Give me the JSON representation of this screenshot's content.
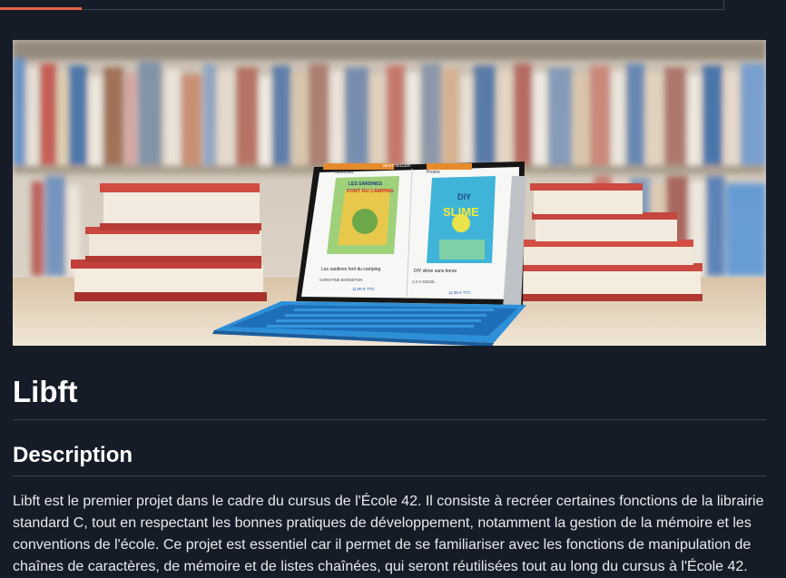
{
  "nav": {
    "active_tab_color": "#e8654a"
  },
  "hero": {
    "image_alt": "Illustration de la librairie Libft",
    "book_left": {
      "tag_top": "Nouveau",
      "tag_mid": "BEST SELLER",
      "cover_title_1": "LES SARDINES",
      "cover_title_2": "FONT DU CAMPING",
      "caption": "Les sardines font du camping",
      "author": "CHRISTINE BONNETON",
      "price": "11,90 € TTC"
    },
    "book_right": {
      "tag_top": "Promo",
      "cover_title_1": "DIY",
      "cover_title_2": "SLIME",
      "caption": "DIY slime sans borax",
      "author": "1-2-3 SOLEIL",
      "price": "11,95 € TTC"
    }
  },
  "project": {
    "title": "Libft",
    "section_title": "Description",
    "description": "Libft est le premier projet dans le cadre du cursus de l'École 42. Il consiste à recréer certaines fonctions de la librairie standard C, tout en respectant les bonnes pratiques de développement, notamment la gestion de la mémoire et les conventions de l'école. Ce projet est essentiel car il permet de se familiariser avec les fonctions de manipulation de chaînes de caractères, de mémoire et de listes chaînées, qui seront réutilisées tout au long du cursus à l'École 42."
  }
}
